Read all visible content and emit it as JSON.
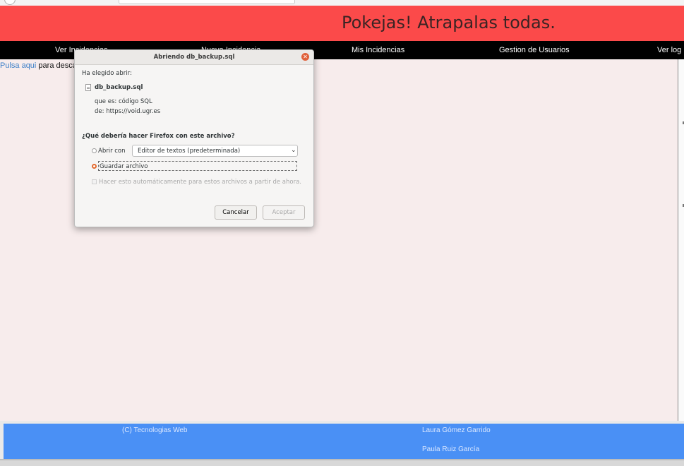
{
  "banner": {
    "title": "Pokejas! Atrapalas todas."
  },
  "nav": {
    "items": [
      {
        "label": "Ver Incidencias"
      },
      {
        "label": "Nueva Incidencia"
      },
      {
        "label": "Mis Incidencias"
      },
      {
        "label": "Gestion de Usuarios"
      },
      {
        "label": "Ver log"
      }
    ]
  },
  "content": {
    "link_text": "Pulsa aqui",
    "rest_text": " para descargar"
  },
  "footer": {
    "left": "(C) Tecnologias Web",
    "authors": [
      "Laura Gómez Garrido",
      "Paula Ruiz García"
    ]
  },
  "dialog": {
    "title": "Abriendo db_backup.sql",
    "chosen_label": "Ha elegido abrir:",
    "filename": "db_backup.sql",
    "type_line": "que es: código SQL",
    "from_line": "de: https://void.ugr.es",
    "question": "¿Qué debería hacer Firefox con este archivo?",
    "open_with_label": "Abrir con",
    "open_with_value": "Editor de textos (predeterminada)",
    "save_label": "Guardar archivo",
    "auto_label": "Hacer esto automáticamente para estos archivos a partir de ahora.",
    "cancel_label": "Cancelar",
    "accept_label": "Aceptar",
    "selected_option": "save"
  },
  "colors": {
    "banner": "#fb4a4a",
    "nav": "#000000",
    "content_bg": "#f7ecec",
    "footer": "#4a90f5",
    "link": "#3a7ec7",
    "radio_selected": "#e36a2f"
  },
  "icons": [
    "file-icon",
    "close-icon",
    "chevron-down-icon"
  ]
}
